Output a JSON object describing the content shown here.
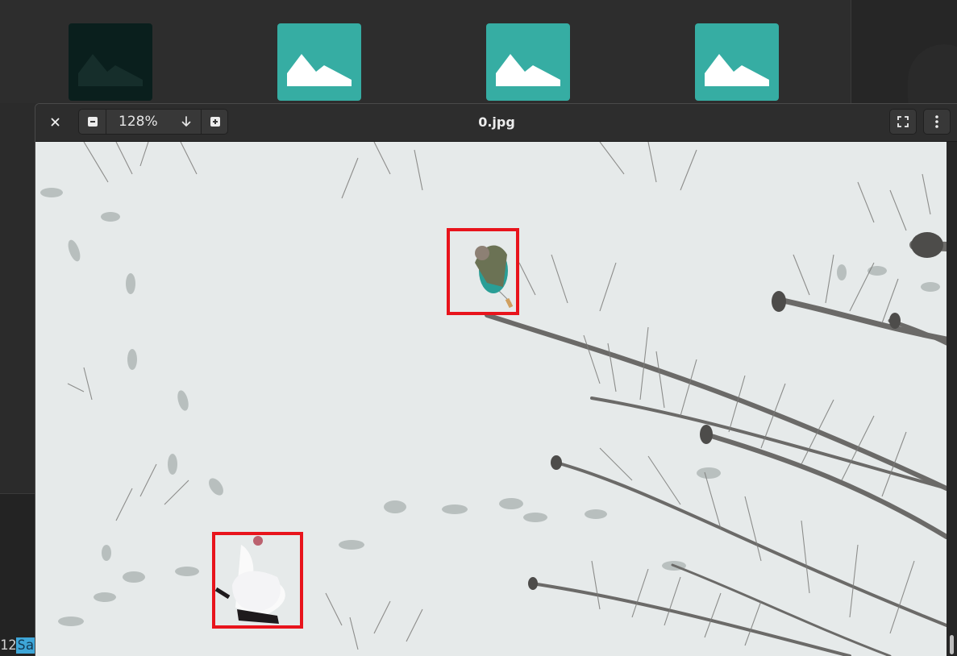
{
  "gallery": {
    "thumbnails": [
      {
        "icon": "image-placeholder-icon",
        "state": "dimmed"
      },
      {
        "icon": "image-placeholder-icon",
        "state": "normal"
      },
      {
        "icon": "image-placeholder-icon",
        "state": "normal"
      },
      {
        "icon": "image-placeholder-icon",
        "state": "normal"
      }
    ]
  },
  "console": {
    "number_fragment": "12",
    "selected_fragment": "Sav"
  },
  "viewer": {
    "title": "0.jpg",
    "zoom_value": "128%",
    "icons": {
      "close": "close-icon",
      "zoom_out": "zoom-out-icon",
      "zoom_dropdown": "arrow-down-icon",
      "zoom_in": "zoom-in-icon",
      "fullscreen": "fullscreen-icon",
      "menu": "more-vertical-icon"
    },
    "image": {
      "scene": "aerial view of snowy forest floor with bare trees and footprints",
      "detection_box_color": "#e8141c",
      "detections": 2
    }
  },
  "colors": {
    "accent_teal": "#36ada3",
    "header_bg": "#2d2d2d",
    "selection_blue": "#3ea6d8"
  }
}
